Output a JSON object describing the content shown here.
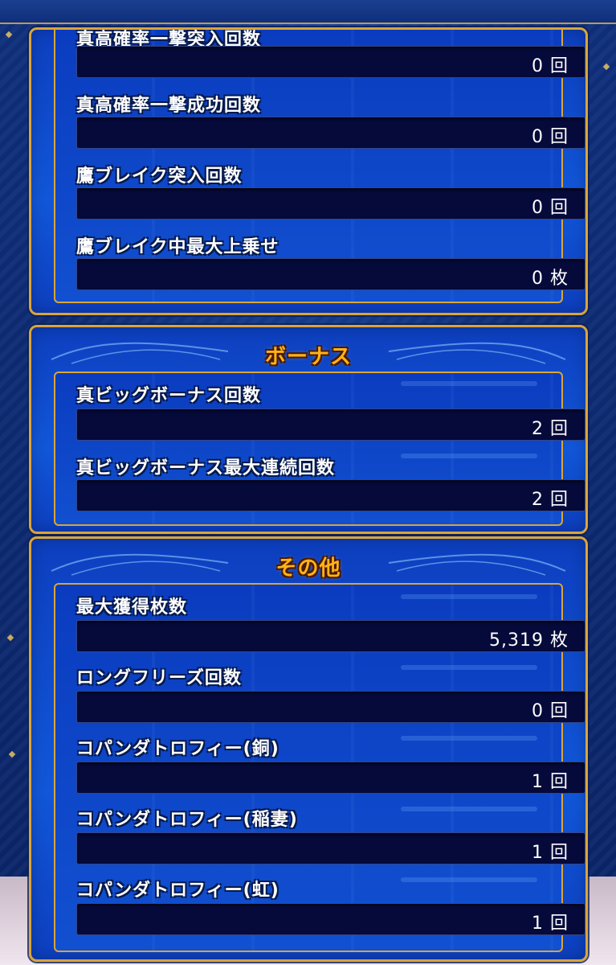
{
  "sections": [
    {
      "title": "",
      "rows": [
        {
          "label": "真高確率一撃突入回数",
          "value": "0 回"
        },
        {
          "label": "真高確率一撃成功回数",
          "value": "0 回"
        },
        {
          "label": "鷹ブレイク突入回数",
          "value": "0 回"
        },
        {
          "label": "鷹ブレイク中最大上乗せ",
          "value": "0 枚"
        }
      ]
    },
    {
      "title": "ボーナス",
      "rows": [
        {
          "label": "真ビッグボーナス回数",
          "value": "2 回"
        },
        {
          "label": "真ビッグボーナス最大連続回数",
          "value": "2 回"
        }
      ]
    },
    {
      "title": "その他",
      "rows": [
        {
          "label": "最大獲得枚数",
          "value": "5,319 枚"
        },
        {
          "label": "ロングフリーズ回数",
          "value": "0 回"
        },
        {
          "label": "コパンダトロフィー(銅)",
          "value": "1 回"
        },
        {
          "label": "コパンダトロフィー(稲妻)",
          "value": "1 回"
        },
        {
          "label": "コパンダトロフィー(虹)",
          "value": "1 回"
        }
      ]
    }
  ],
  "colors": {
    "panel_blue": "#1157d9",
    "gold_border": "#d9a53a",
    "title_orange": "#ffb21a",
    "value_box": "#050a3a"
  }
}
